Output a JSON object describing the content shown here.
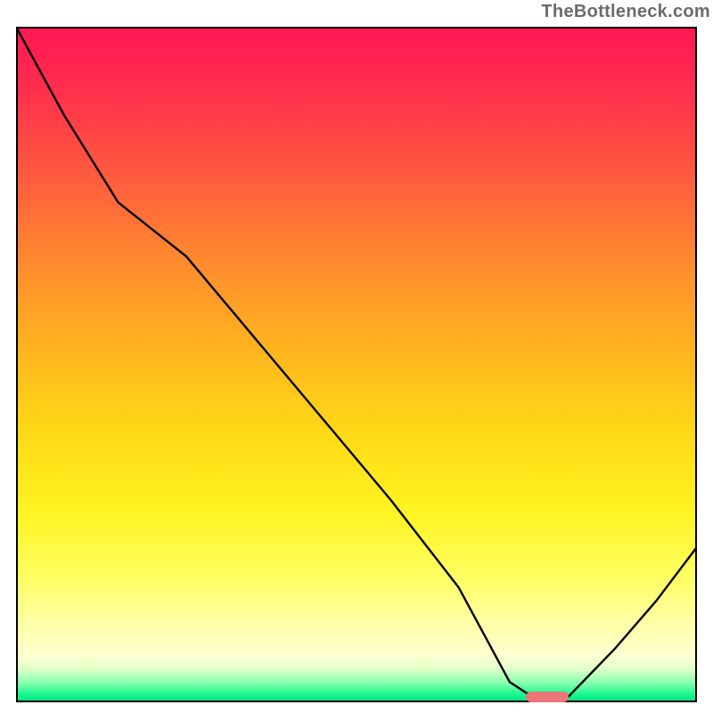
{
  "watermark": "TheBottleneck.com",
  "chart_data": {
    "type": "line",
    "title": "",
    "xlabel": "",
    "ylabel": "",
    "xlim": [
      0,
      100
    ],
    "ylim": [
      0,
      100
    ],
    "grid": false,
    "series": [
      {
        "name": "bottleneck-curve",
        "x": [
          0,
          7,
          15,
          25,
          35,
          45,
          55,
          65,
          72.5,
          76,
          81,
          88,
          94,
          100
        ],
        "y": [
          100,
          87,
          74,
          66,
          54,
          42,
          30,
          17,
          3,
          0.7,
          0.7,
          8,
          15,
          23
        ]
      }
    ],
    "marker": {
      "name": "optimal-range-pill",
      "x_center": 78,
      "y": 0.8,
      "color": "#ec7577"
    }
  }
}
